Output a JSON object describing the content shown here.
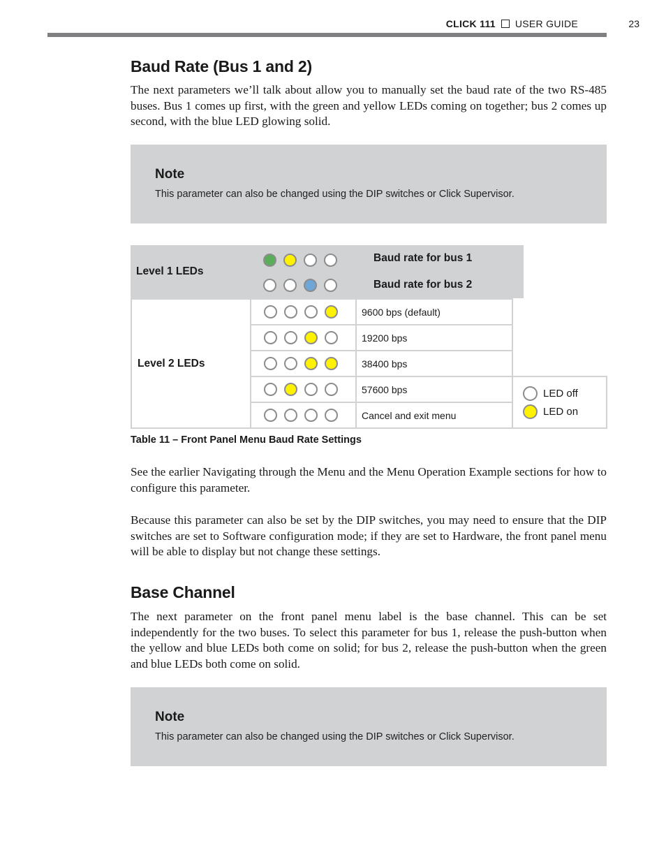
{
  "header": {
    "product": "CLICK 111",
    "separator_icon": "square-icon",
    "section": "USER GUIDE",
    "page_number": "23"
  },
  "section1": {
    "title": "Baud Rate (Bus 1 and 2)",
    "paragraph": "The next parameters we’ll talk about allow you to manually set the baud rate of the two RS-485 buses. Bus 1 comes up first, with the green and yellow LEDs coming on together; bus 2 comes up second, with the blue LED glowing solid.",
    "note": {
      "title": "Note",
      "text": "This parameter can also be changed using the DIP switches or Click Supervisor."
    },
    "table": {
      "colors": {
        "green": "#5aae5a",
        "yellow": "#fff200",
        "blue": "#6ea6d8",
        "off": "#ffffff",
        "border": "#8c8c8c",
        "shade": "#d1d2d4"
      },
      "level1": {
        "label": "Level 1 LEDs",
        "rows": [
          {
            "leds": [
              "green",
              "yellow",
              "off",
              "off"
            ],
            "label": "Baud rate for bus 1"
          },
          {
            "leds": [
              "off",
              "off",
              "blue",
              "off"
            ],
            "label": "Baud rate for bus 2"
          }
        ]
      },
      "level2": {
        "label": "Level 2 LEDs",
        "rows": [
          {
            "leds": [
              "off",
              "off",
              "off",
              "yellow"
            ],
            "label": "9600 bps (default)"
          },
          {
            "leds": [
              "off",
              "off",
              "yellow",
              "off"
            ],
            "label": "19200 bps"
          },
          {
            "leds": [
              "off",
              "off",
              "yellow",
              "yellow"
            ],
            "label": "38400 bps"
          },
          {
            "leds": [
              "off",
              "yellow",
              "off",
              "off"
            ],
            "label": "57600 bps"
          },
          {
            "leds": [
              "off",
              "off",
              "off",
              "off"
            ],
            "label": "Cancel and exit menu"
          }
        ]
      },
      "legend": [
        {
          "state": "off",
          "label": "LED off"
        },
        {
          "state": "yellow",
          "label": "LED on"
        }
      ],
      "caption": "Table 11 – Front Panel Menu Baud Rate Settings"
    },
    "paragraph2": "See the earlier Navigating through the Menu and the Menu Operation Example sections for how to configure this parameter.",
    "paragraph3": "Because this parameter can also be set by the DIP switches, you may need to ensure that the DIP switches are set to Software configuration mode; if they are set to Hardware, the front panel menu will be able to display but not change these settings."
  },
  "section2": {
    "title": "Base Channel",
    "paragraph": "The next parameter on the front panel menu label is the base channel. This can be set independently for the two buses. To select this parameter for bus 1, release the push-button when the yellow and blue LEDs both come on solid; for bus 2, release the push-button when the green and blue LEDs both come on solid.",
    "note": {
      "title": "Note",
      "text": "This parameter can also be changed using the DIP switches or Click Supervisor."
    }
  }
}
